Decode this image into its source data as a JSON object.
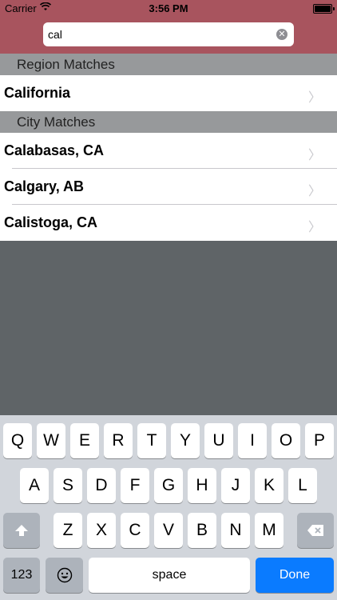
{
  "status": {
    "carrier": "Carrier",
    "time": "3:56 PM"
  },
  "search": {
    "value": "cal"
  },
  "sections": [
    {
      "header": "Region Matches",
      "rows": [
        "California"
      ]
    },
    {
      "header": "City Matches",
      "rows": [
        "Calabasas, CA",
        "Calgary, AB",
        "Calistoga, CA"
      ]
    }
  ],
  "keyboard": {
    "row1": [
      "Q",
      "W",
      "E",
      "R",
      "T",
      "Y",
      "U",
      "I",
      "O",
      "P"
    ],
    "row2": [
      "A",
      "S",
      "D",
      "F",
      "G",
      "H",
      "J",
      "K",
      "L"
    ],
    "row3": [
      "Z",
      "X",
      "C",
      "V",
      "B",
      "N",
      "M"
    ],
    "numbers": "123",
    "space": "space",
    "done": "Done"
  },
  "colors": {
    "bar": "#a8545e",
    "done": "#0a7bff",
    "header": "#97999b"
  }
}
